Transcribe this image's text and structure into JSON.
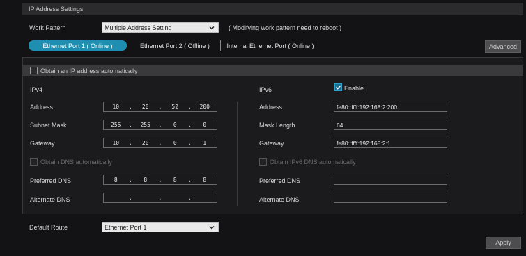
{
  "header": {
    "title": "IP Address Settings"
  },
  "work_pattern": {
    "label": "Work Pattern",
    "value": "Multiple Address Setting",
    "note": "( Modifying work pattern need to reboot )"
  },
  "tabs": [
    {
      "label": "Ethernet Port 1 ( Online )",
      "active": true
    },
    {
      "label": "Ethernet Port 2 ( Offline )",
      "active": false
    },
    {
      "label": "Internal Ethernet Port ( Online )",
      "active": false
    }
  ],
  "advanced_button": "Advanced",
  "obtain_auto": {
    "label": "Obtain an IP address automatically",
    "checked": false
  },
  "ipv4": {
    "title": "IPv4",
    "address": {
      "label": "Address",
      "octets": [
        "10",
        "20",
        "52",
        "200"
      ]
    },
    "subnet": {
      "label": "Subnet Mask",
      "octets": [
        "255",
        "255",
        "0",
        "0"
      ]
    },
    "gateway": {
      "label": "Gateway",
      "octets": [
        "10",
        "20",
        "0",
        "1"
      ]
    },
    "obtain_dns": {
      "label": "Obtain DNS automatically",
      "checked": false
    },
    "preferred_dns": {
      "label": "Preferred DNS",
      "octets": [
        "8",
        "8",
        "8",
        "8"
      ]
    },
    "alternate_dns": {
      "label": "Alternate DNS",
      "octets": [
        "",
        "",
        "",
        ""
      ]
    }
  },
  "ipv6": {
    "title": "IPv6",
    "enable": {
      "label": "Enable",
      "checked": true
    },
    "address": {
      "label": "Address",
      "value": "fe80::ffff:192:168:2:200"
    },
    "mask_length": {
      "label": "Mask Length",
      "value": "64"
    },
    "gateway": {
      "label": "Gateway",
      "value": "fe80::ffff:192:168:2:1"
    },
    "obtain_dns": {
      "label": "Obtain IPv6 DNS automatically",
      "checked": false
    },
    "preferred_dns": {
      "label": "Preferred DNS",
      "value": ""
    },
    "alternate_dns": {
      "label": "Alternate DNS",
      "value": ""
    }
  },
  "default_route": {
    "label": "Default Route",
    "value": "Ethernet Port 1"
  },
  "apply_button": "Apply"
}
